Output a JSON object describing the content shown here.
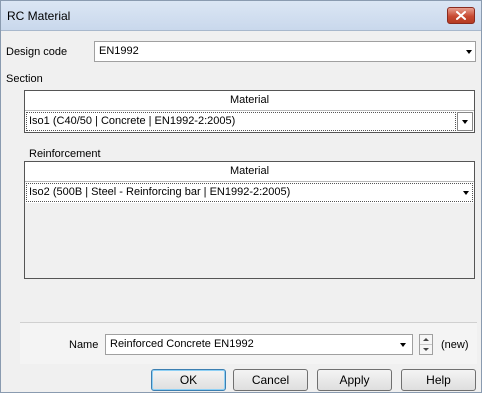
{
  "window": {
    "title": "RC Material",
    "close_icon": "close-icon"
  },
  "design_code": {
    "label": "Design code",
    "value": "EN1992"
  },
  "section": {
    "label": "Section",
    "column_header": "Material",
    "row_value": "Iso1 (C40/50 | Concrete | EN1992-2:2005)"
  },
  "reinforcement": {
    "label": "Reinforcement",
    "column_header": "Material",
    "row_value": "Iso2 (500B | Steel - Reinforcing bar | EN1992-2:2005)"
  },
  "name_field": {
    "label": "Name",
    "value": "Reinforced Concrete EN1992",
    "status": "(new)"
  },
  "buttons": {
    "ok": "OK",
    "cancel": "Cancel",
    "apply": "Apply",
    "help": "Help"
  },
  "colors": {
    "close_button": "#c84a32",
    "title_bar": "#dbe6f4",
    "ok_focus": "#3c7fb1"
  }
}
